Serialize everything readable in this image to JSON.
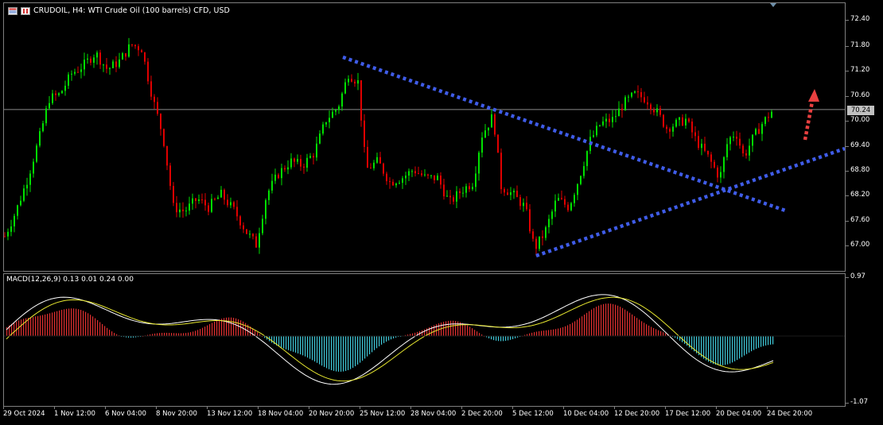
{
  "header": {
    "title": "CRUDOIL, H4:  WTI Crude Oil (100 barrels) CFD, USD",
    "icons": [
      "chart-grid-icon",
      "calendar-icon"
    ]
  },
  "price_axis": {
    "ticks": [
      "72.40",
      "71.80",
      "71.20",
      "70.60",
      "70.00",
      "69.40",
      "68.80",
      "68.20",
      "67.60",
      "67.00"
    ],
    "current_price": "70.24"
  },
  "macd": {
    "label": "MACD(12,26,9) 0.13 0.01 0.24 0.00",
    "axis_top": "0.97",
    "axis_bottom": "-1.07"
  },
  "time_axis": {
    "ticks": [
      "29 Oct 2024",
      "1 Nov 12:00",
      "6 Nov 04:00",
      "8 Nov 20:00",
      "13 Nov 12:00",
      "18 Nov 04:00",
      "20 Nov 20:00",
      "25 Nov 12:00",
      "28 Nov 04:00",
      "2 Dec 20:00",
      "5 Dec 12:00",
      "10 Dec 04:00",
      "12 Dec 20:00",
      "17 Dec 12:00",
      "20 Dec 04:00",
      "24 Dec 20:00"
    ]
  },
  "colors": {
    "up_candle": "#00e000",
    "down_candle": "#e00000",
    "trendline": "#3f5ce8",
    "arrow": "#e84040",
    "hist_pos": "#e03030",
    "hist_neg": "#40c8d8",
    "macd_line": "#ffffff",
    "signal_line": "#e8e830"
  }
}
